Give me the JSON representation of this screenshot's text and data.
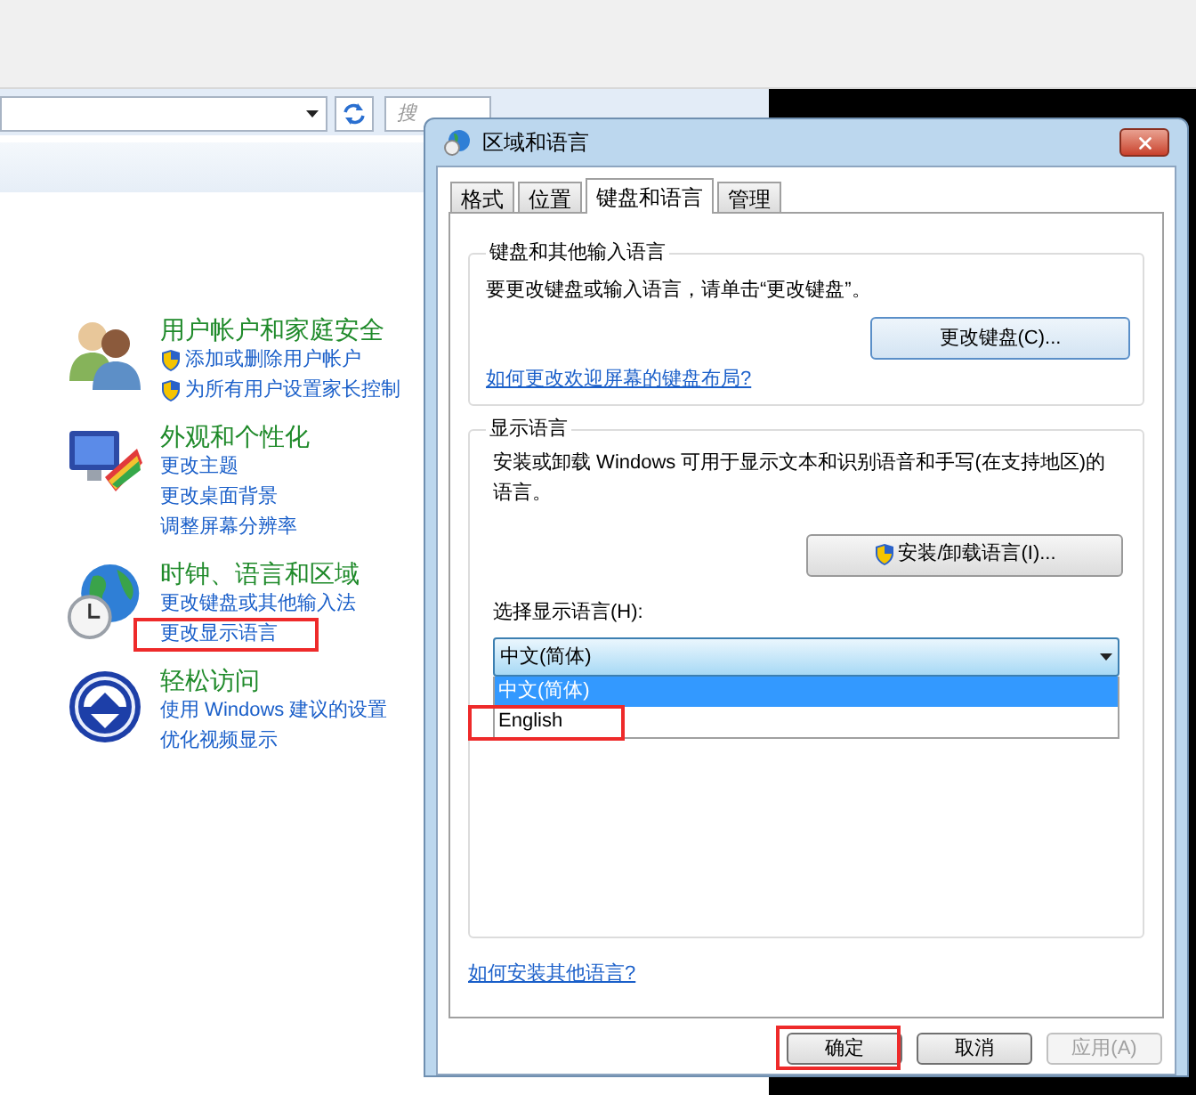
{
  "background_window": {
    "search": {
      "placeholder": "搜"
    },
    "categories": [
      {
        "kind": "users",
        "title": "用户帐户和家庭安全",
        "links": [
          {
            "label": "添加或删除用户帐户",
            "shield": true,
            "highlighted": false
          },
          {
            "label": "为所有用户设置家长控制",
            "shield": true,
            "highlighted": false
          }
        ]
      },
      {
        "kind": "appearance",
        "title": "外观和个性化",
        "links": [
          {
            "label": "更改主题",
            "shield": false,
            "highlighted": false
          },
          {
            "label": "更改桌面背景",
            "shield": false,
            "highlighted": false
          },
          {
            "label": "调整屏幕分辨率",
            "shield": false,
            "highlighted": false
          }
        ]
      },
      {
        "kind": "clock",
        "title": "时钟、语言和区域",
        "links": [
          {
            "label": "更改键盘或其他输入法",
            "shield": false,
            "highlighted": false
          },
          {
            "label": "更改显示语言",
            "shield": false,
            "highlighted": true
          }
        ]
      },
      {
        "kind": "access",
        "title": "轻松访问",
        "links": [
          {
            "label": "使用 Windows 建议的设置",
            "shield": false,
            "highlighted": false
          },
          {
            "label": "优化视频显示",
            "shield": false,
            "highlighted": false
          }
        ]
      }
    ]
  },
  "dialog": {
    "title": "区域和语言",
    "tabs": [
      {
        "label": "格式",
        "selected": false
      },
      {
        "label": "位置",
        "selected": false
      },
      {
        "label": "键盘和语言",
        "selected": true
      },
      {
        "label": "管理",
        "selected": false
      }
    ],
    "keyboard_group": {
      "title": "键盘和其他输入语言",
      "text": "要更改键盘或输入语言，请单击“更改键盘”。",
      "button": "更改键盘(C)...",
      "link": "如何更改欢迎屏幕的键盘布局?"
    },
    "display_group": {
      "title": "显示语言",
      "text": "安装或卸载 Windows 可用于显示文本和识别语音和手写(在支持地区)的语言。",
      "button": "安装/卸载语言(I)...",
      "select_label": "选择显示语言(H):",
      "select_value": "中文(简体)",
      "options": [
        {
          "label": "中文(简体)",
          "selected": true,
          "highlighted": false
        },
        {
          "label": "English",
          "selected": false,
          "highlighted": true
        }
      ]
    },
    "link": "如何安装其他语言?",
    "buttons": [
      {
        "label": "确定",
        "disabled": false,
        "highlighted": true
      },
      {
        "label": "取消",
        "disabled": false,
        "highlighted": false
      },
      {
        "label": "应用(A)",
        "disabled": true,
        "highlighted": false
      }
    ]
  }
}
